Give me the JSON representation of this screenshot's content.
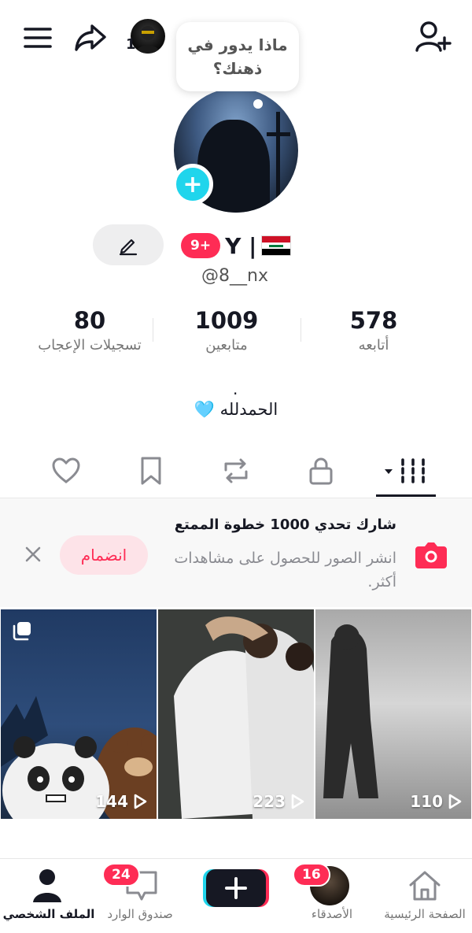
{
  "top_bar": {
    "mini_avatar_count": "1",
    "thought_bubble": "ماذا يدور في ذهنك؟"
  },
  "profile": {
    "name": "Y |",
    "notification_badge": "9+",
    "flag": "iraq-flag",
    "handle": "@8__nx",
    "bio_dot": ".",
    "bio": "الحمدلله 🩵"
  },
  "stats": {
    "following": {
      "value": "578",
      "label": "أتابعه"
    },
    "followers": {
      "value": "1009",
      "label": "متابعين"
    },
    "likes": {
      "value": "80",
      "label": "تسجيلات الإعجاب"
    }
  },
  "tabs": [
    {
      "name": "videos",
      "icon": "grid-icon",
      "active": true
    },
    {
      "name": "private",
      "icon": "lock-icon",
      "active": false
    },
    {
      "name": "reposts",
      "icon": "repost-icon",
      "active": false
    },
    {
      "name": "favorites",
      "icon": "bookmark-icon",
      "active": false
    },
    {
      "name": "liked",
      "icon": "heart-icon",
      "active": false
    }
  ],
  "banner": {
    "title": "شارك تحدي 1000 خطوة الممتع",
    "description": "انشر الصور للحصول على مشاهدات أكثر.",
    "join_label": "انضمام",
    "accent": "#fe2c55"
  },
  "videos": [
    {
      "views": "144",
      "multi_photo": true
    },
    {
      "views": "223",
      "multi_photo": false
    },
    {
      "views": "110",
      "multi_photo": false
    }
  ],
  "bottom_nav": {
    "home": "الصفحة الرئيسية",
    "friends": "الأصدقاء",
    "friends_count": "16",
    "inbox": "صندوق الوارد",
    "inbox_count": "24",
    "profile": "الملف الشخصي"
  },
  "colors": {
    "accent_pink": "#fe2c55",
    "accent_cyan": "#20d5ec",
    "text_primary": "#161823",
    "text_secondary": "#757575"
  }
}
